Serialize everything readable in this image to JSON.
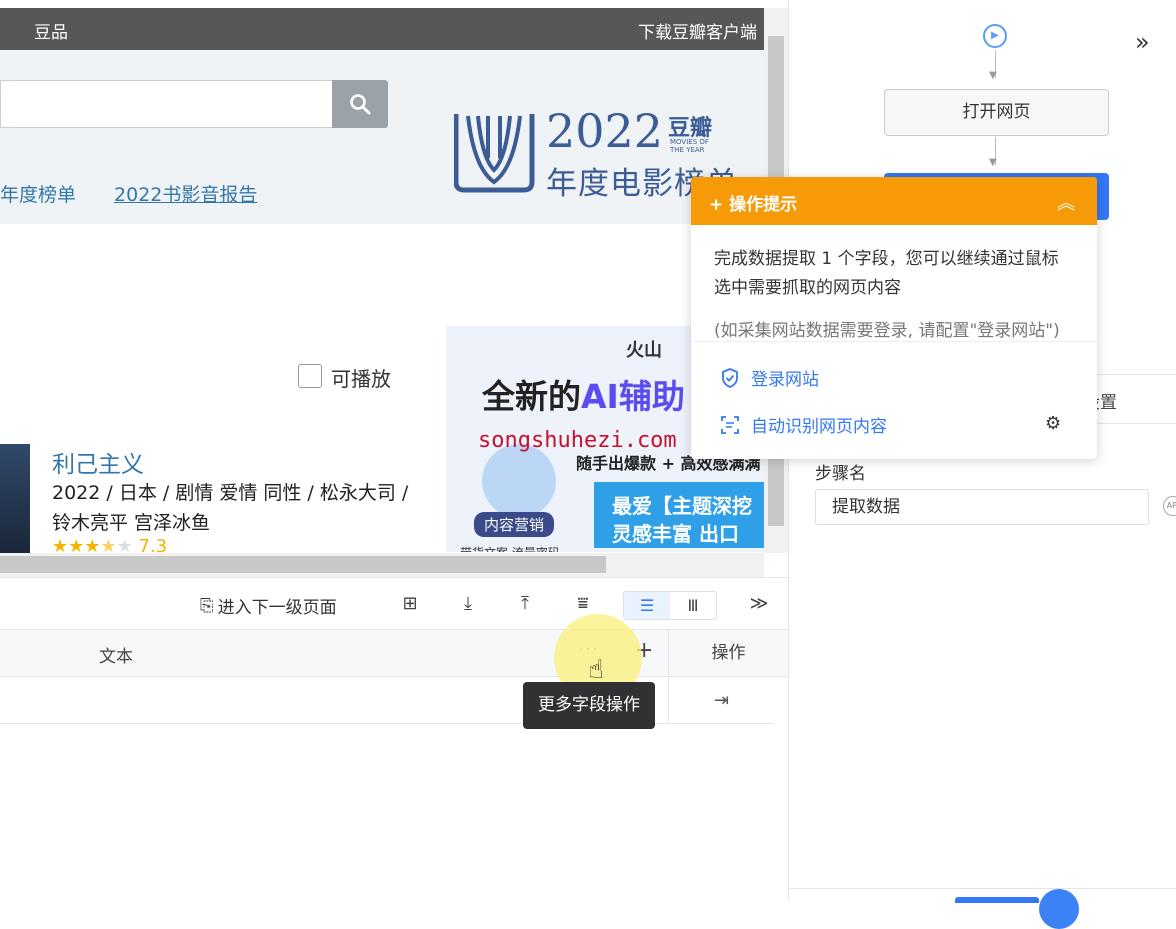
{
  "topbar": {
    "left_item": "豆品",
    "right_item": "下载豆瓣客户端"
  },
  "nav": {
    "year_list": "年度榜单",
    "report": "2022书影音报告"
  },
  "banner": {
    "year": "2022",
    "brand": "豆瓣",
    "moty": "MOVIES OF THE YEAR",
    "subtitle": "年度电影榜单"
  },
  "filter": {
    "playable_label": "可播放"
  },
  "ad": {
    "brand": "火山",
    "title_prefix": "全新的",
    "title_ai": "AI辅助",
    "line1": "随手出爆款 + 高效感满满",
    "tag": "内容营销",
    "box_line1": "最爱【主题深挖",
    "box_line2": "灵感丰富 出口",
    "foot": "带货文案 流量密码"
  },
  "movie": {
    "title": "利己主义",
    "meta1": "2022 / 日本 / 剧情 爱情 同性 / 松永大司 /",
    "meta2": "铃木亮平 宫泽冰鱼",
    "stars_full": "★★★",
    "stars_half": "★",
    "stars_empty": "★",
    "rating": "7.3",
    "rating_value": 7.3
  },
  "watermark": "songshuhezi.com",
  "toolbar": {
    "enter_next": "进入下一级页面",
    "icons": [
      "add-page-icon",
      "download-icon",
      "upload-icon",
      "filter-icon"
    ],
    "view_list_glyph": "☰",
    "view_column_glyph": "Ⅲ",
    "expand_glyph": "≫"
  },
  "table": {
    "col_text": "文本",
    "col_more": "···",
    "col_plus": "+",
    "col_ops": "操作",
    "row_op_glyph": "⇥"
  },
  "tooltip": "更多字段操作",
  "flow": {
    "open_page": "打开网页",
    "collapse_glyph": "»"
  },
  "settings": {
    "tab_label": "设置",
    "step_name_label": "步骤名",
    "step_name_value": "提取数据",
    "api_badge": "API"
  },
  "popover": {
    "title": "+ 操作提示",
    "collapse_glyph": "︽",
    "message": "完成数据提取 1 个字段，您可以继续通过鼠标选中需要抓取的网页内容",
    "note": "(如采集网站数据需要登录, 请配置\"登录网站\")",
    "login_link": "登录网站",
    "auto_detect_link": "自动识别网页内容"
  },
  "colors": {
    "accent": "#3478f6",
    "warning": "#f79a07",
    "link": "#3377aa"
  }
}
